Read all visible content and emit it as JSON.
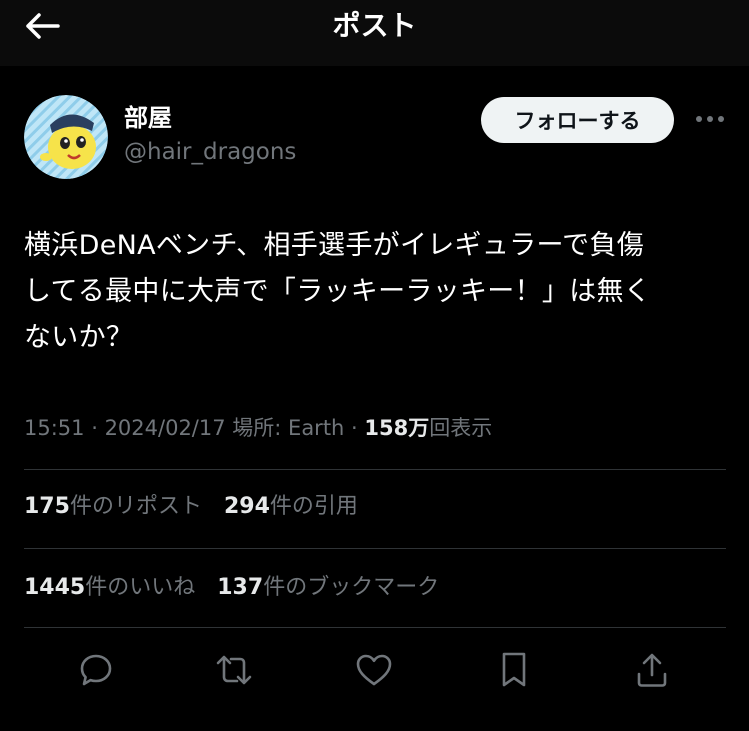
{
  "header": {
    "title": "ポスト",
    "back_icon": "back-arrow-icon"
  },
  "author": {
    "name": "部屋",
    "handle": "@hair_dragons"
  },
  "follow_label": "フォローする",
  "more_icon": "more-horizontal-icon",
  "tweet": {
    "text": "横浜DeNAベンチ、相手選手がイレギュラーで負傷\nしてる最中に大声で「ラッキーラッキー！」は無く\nないか？"
  },
  "meta": {
    "time": "15:51",
    "date": "2024/02/17",
    "location": "場所: Earth",
    "views_count": "158万",
    "views_label": "回表示"
  },
  "stats": {
    "reposts_count": "175",
    "reposts_label": "件のリポスト",
    "quotes_count": "294",
    "quotes_label": "件の引用",
    "likes_count": "1445",
    "likes_label": "件のいいね",
    "bookmarks_count": "137",
    "bookmarks_label": "件のブックマーク"
  },
  "actions": [
    "reply-icon",
    "repost-icon",
    "like-icon",
    "bookmark-icon",
    "share-icon"
  ],
  "colors": {
    "background": "#000000",
    "text": "#e7e9ea",
    "secondary": "#71767b",
    "divider": "#2f3336",
    "follow_button": "#eff3f4"
  }
}
